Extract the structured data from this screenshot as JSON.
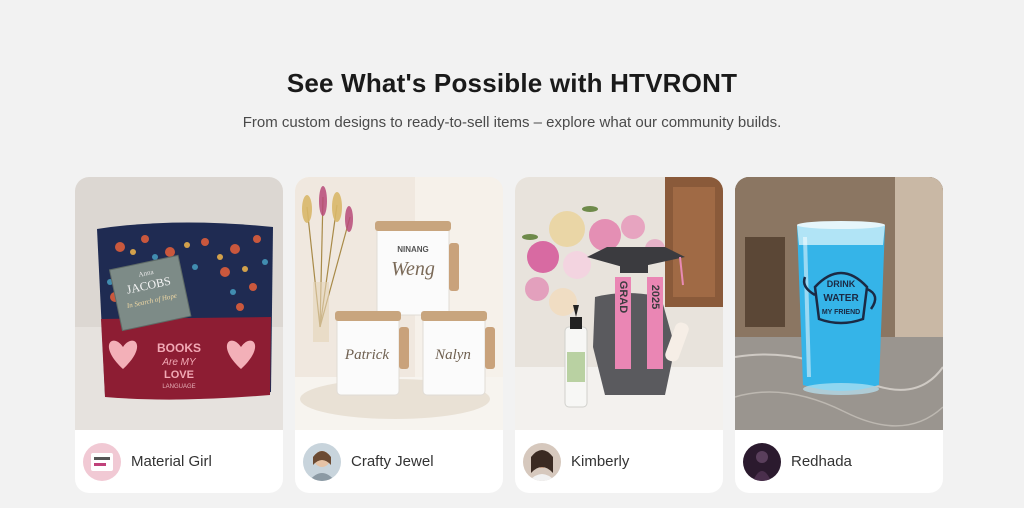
{
  "header": {
    "title": "See What's Possible with HTVRONT",
    "subtitle": "From custom designs to ready-to-sell items – explore what our community builds."
  },
  "cards": [
    {
      "author": "Material Girl",
      "avatar": "avatar-material-girl",
      "image": "pillow-photo",
      "texts": {
        "book_author": "Anna",
        "book_title": "JACOBS",
        "book_sub": "In Search of Hope",
        "pocket_1": "BOOKS",
        "pocket_2": "Are MY",
        "pocket_3": "LOVE",
        "pocket_4": "LANGUAGE"
      }
    },
    {
      "author": "Crafty Jewel",
      "avatar": "avatar-crafty-jewel",
      "image": "mugs-photo",
      "texts": {
        "mug_top_1": "NINANG",
        "mug_top_2": "Weng",
        "mug_left": "Patrick",
        "mug_right": "Nalyn"
      }
    },
    {
      "author": "Kimberly",
      "avatar": "avatar-kimberly",
      "image": "graduation-photo",
      "texts": {
        "grad_left": "GRAD",
        "grad_right": "2025"
      }
    },
    {
      "author": "Redhada",
      "avatar": "avatar-redhada",
      "image": "glass-photo",
      "texts": {
        "glass_1": "DRINK",
        "glass_2": "WATER",
        "glass_3": "MY FRIEND"
      }
    }
  ],
  "colors": {
    "background": "#f2f2f2",
    "card": "#ffffff",
    "title": "#1a1a1a",
    "text": "#4a4a4a"
  }
}
